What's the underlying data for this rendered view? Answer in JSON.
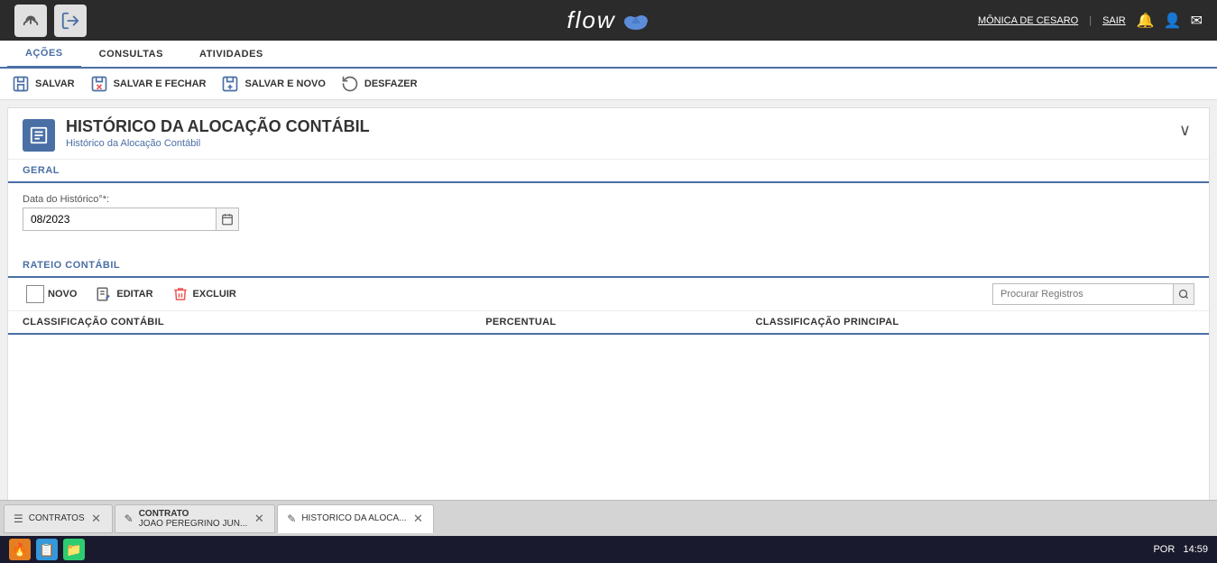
{
  "header": {
    "logo_text": "flow",
    "user_name": "MÔNICA DE CESARO",
    "sair_label": "SAIR",
    "icons": {
      "cloud": "☁",
      "bell": "🔔",
      "user": "👤",
      "mail": "✉"
    }
  },
  "nav": {
    "tabs": [
      {
        "label": "AÇÕES",
        "active": true
      },
      {
        "label": "CONSULTAS",
        "active": false
      },
      {
        "label": "ATIVIDADES",
        "active": false
      }
    ]
  },
  "toolbar": {
    "buttons": [
      {
        "label": "SALVAR",
        "icon": "save"
      },
      {
        "label": "SALVAR E FECHAR",
        "icon": "save-close"
      },
      {
        "label": "SALVAR E NOVO",
        "icon": "save-new"
      },
      {
        "label": "DESFAZER",
        "icon": "undo"
      }
    ]
  },
  "page": {
    "title": "HISTÓRICO DA ALOCAÇÃO CONTÁBIL",
    "subtitle": "Histórico da Alocação Contábil"
  },
  "geral_section": {
    "label": "GERAL",
    "data_historico_label": "Data do Histórico°*:",
    "data_historico_value": "08/2023"
  },
  "rateio_section": {
    "label": "RATEIO CONTÁBIL",
    "buttons": {
      "novo": "NOVO",
      "editar": "EDITAR",
      "excluir": "EXCLUIR"
    },
    "search_placeholder": "Procurar Registros",
    "columns": [
      {
        "label": "CLASSIFICAÇÃO CONTÁBIL"
      },
      {
        "label": "PERCENTUAL"
      },
      {
        "label": "CLASSIFICAÇÃO PRINCIPAL"
      }
    ],
    "rows": []
  },
  "bottom_tabs": [
    {
      "label": "CONTRATOS",
      "icon": "list",
      "active": false,
      "closeable": true
    },
    {
      "label": "CONTRATO",
      "sublabel": "JOÃO PEREGRINO JÚN...",
      "icon": "pencil",
      "active": false,
      "closeable": true
    },
    {
      "label": "HISTÓRICO DA ALOCA...",
      "icon": "pencil",
      "active": true,
      "closeable": true
    }
  ],
  "taskbar": {
    "time": "14:59",
    "lang": "POR"
  }
}
